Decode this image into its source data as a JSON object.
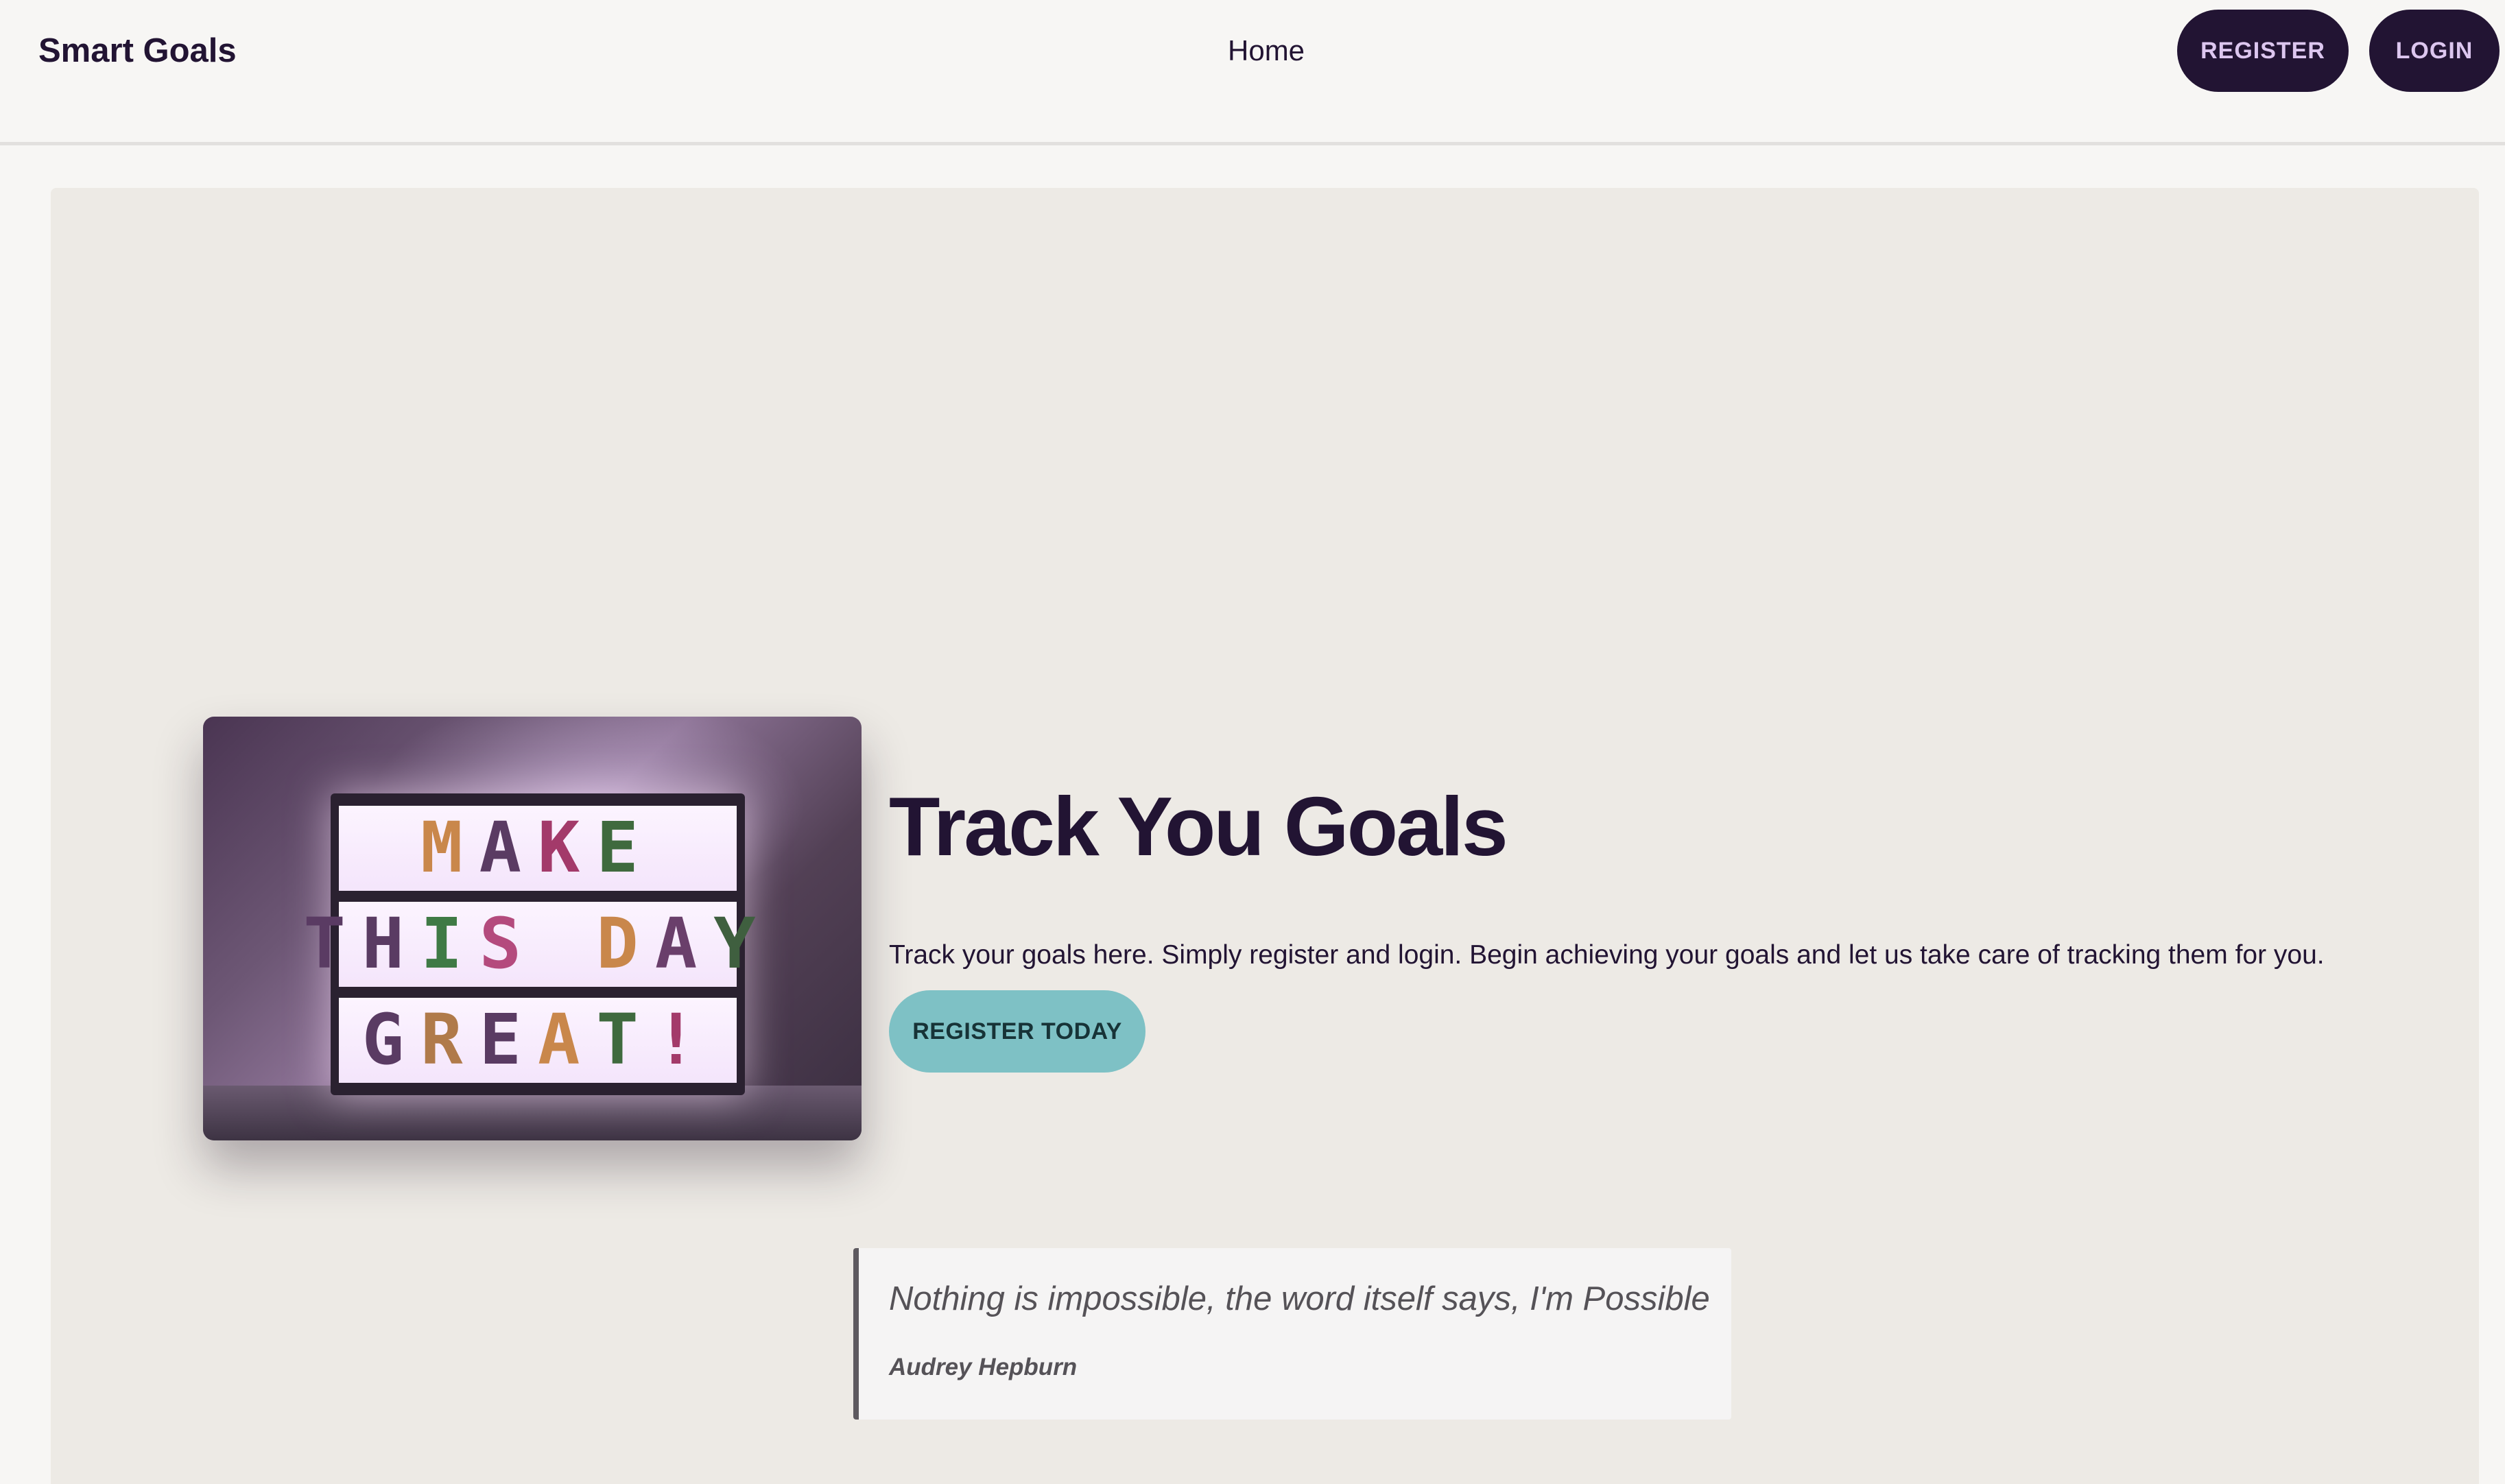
{
  "nav": {
    "brand": "Smart Goals",
    "home_link": "Home",
    "register_label": "REGISTER",
    "login_label": "LOGIN"
  },
  "hero": {
    "image": {
      "lightbox_rows": [
        {
          "letters": [
            "M",
            "A",
            "K",
            "E"
          ],
          "colors": [
            "#c9874b",
            "#5a3b63",
            "#a33a6a",
            "#3f6a3e"
          ]
        },
        {
          "letters": [
            "T",
            "H",
            "I",
            "S",
            " ",
            "D",
            "A",
            "Y"
          ],
          "colors": [
            "#5a3b63",
            "#5a3b63",
            "#3f7a45",
            "#b44a7d",
            "#000000",
            "#c9874b",
            "#6a3f6b",
            "#3f5f3f"
          ]
        },
        {
          "letters": [
            "G",
            "R",
            "E",
            "A",
            "T",
            "!"
          ],
          "colors": [
            "#5a3b63",
            "#b07a4a",
            "#5a3b63",
            "#c9874b",
            "#3f6a3e",
            "#a33a6a"
          ]
        }
      ]
    },
    "title": "Track You Goals",
    "description": "Track your goals here. Simply register and login. Begin achieving your goals and let us take care of tracking them for you.",
    "cta_label": "REGISTER TODAY"
  },
  "quote": {
    "text": "Nothing is impossible, the word itself says, I'm Possible",
    "author": "Audrey Hepburn"
  },
  "colors": {
    "brand_dark": "#221433",
    "button_text": "#dcc6ef",
    "cta_teal": "#7ec1c5",
    "hero_bg": "#edeae5",
    "page_bg": "#f7f6f4"
  }
}
